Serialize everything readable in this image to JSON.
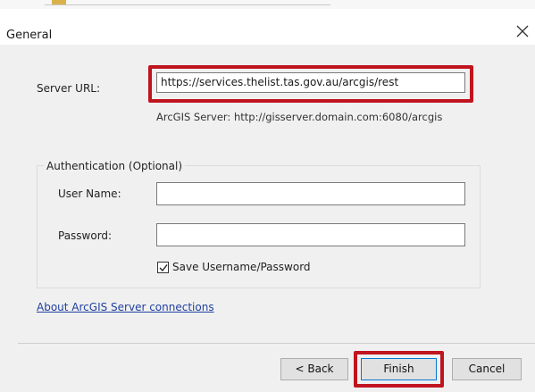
{
  "dialog": {
    "title": "General"
  },
  "server": {
    "label": "Server URL:",
    "value": "https://services.thelist.tas.gov.au/arcgis/rest",
    "hint": "ArcGIS Server: http://gisserver.domain.com:6080/arcgis"
  },
  "authentication": {
    "legend": "Authentication (Optional)",
    "username_label": "User Name:",
    "username_value": "",
    "password_label": "Password:",
    "password_value": "",
    "save_label": "Save Username/Password",
    "save_checked": true
  },
  "link": {
    "about": "About ArcGIS Server connections"
  },
  "buttons": {
    "back": "< Back",
    "finish": "Finish",
    "cancel": "Cancel"
  },
  "colors": {
    "highlight": "#c0141e",
    "link": "#1f3fa0",
    "default_button_border": "#0078d7"
  },
  "icons": {
    "close": "close-icon",
    "checkmark": "checkmark-icon"
  }
}
